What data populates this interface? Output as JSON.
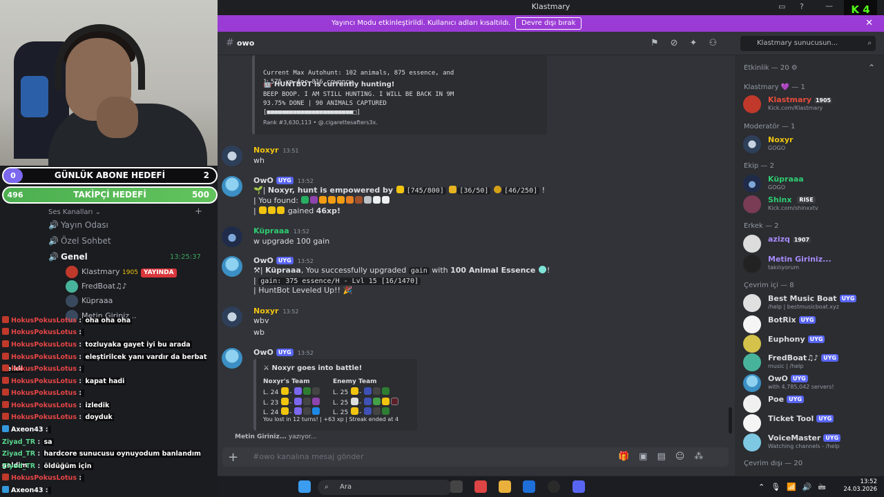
{
  "window": {
    "title": "Klastmary",
    "kick_label": "4"
  },
  "banner": {
    "text": "Yayıncı Modu etkinleştirildi. Kullanıcı adları kısaltıldı.",
    "button": "Devre dışı bırak"
  },
  "channel": {
    "name": "owo",
    "search_placeholder": "Klastmary sunucusun..."
  },
  "goals": [
    {
      "left": "0",
      "title": "GÜNLÜK ABONE HEDEFİ",
      "right": "2"
    },
    {
      "left": "496",
      "title": "TAKİPÇİ HEDEFİ",
      "right": "500"
    }
  ],
  "left": {
    "voice_header": "Ses Kanalları",
    "channels": [
      "Yayın Odası",
      "Özel Sohbet"
    ],
    "genel": {
      "name": "Genel",
      "timer": "13:25:37"
    },
    "voice_users": [
      {
        "name": "Klastmary",
        "tag": "1905",
        "live": "YAYINDA"
      },
      {
        "name": "FredBoat♫♪"
      },
      {
        "name": "Küpraaa"
      },
      {
        "name": "Metin Giriniz..."
      }
    ]
  },
  "overlay_chat": [
    {
      "user": "HokusPokusLotus",
      "msg": "oha oha oha"
    },
    {
      "user": "HokusPokusLotus",
      "msg": ""
    },
    {
      "user": "HokusPokusLotus",
      "msg": "tozluyaka gayet iyi bu arada"
    },
    {
      "user": "HokusPokusLotus",
      "msg": "eleştirilcek yanı vardır da berbat deildi"
    },
    {
      "user": "HokusPokusLotus",
      "msg": ""
    },
    {
      "user": "HokusPokusLotus",
      "msg": "kapat hadi"
    },
    {
      "user": "HokusPokusLotus",
      "msg": ""
    },
    {
      "user": "HokusPokusLotus",
      "msg": "izledik"
    },
    {
      "user": "HokusPokusLotus",
      "msg": "doyduk"
    },
    {
      "user": "Axeon43",
      "msg": ""
    },
    {
      "user": "Ziyad_TR",
      "msg": "sa"
    },
    {
      "user": "Ziyad_TR",
      "msg": "hardcore sunucusu oynuyodum banlandım geldim"
    },
    {
      "user": "Ziyad_TR",
      "msg": "öldüğüm için"
    },
    {
      "user": "HokusPokusLotus",
      "msg": ""
    },
    {
      "user": "Axeon43",
      "msg": ""
    }
  ],
  "messages": {
    "huntbot_embed": {
      "line1": "Current Max Autohunt: 102 animals, 875 essence, and",
      "line2": "1,575 xp for 816 cowoncy",
      "hunting": "HUNTBOT is currently hunting!",
      "beep": "BEEP BOOP. I AM STILL HUNTING. I WILL BE BACK IN 9M",
      "done": "93.75% DONE | 90 ANIMALS CAPTURED",
      "bar": "[■■■■■■■■■■■■■■■■■■■■■■■□]",
      "rank": "Rank #3,630,113 • @.cigarettesafters3x."
    },
    "m1": {
      "user": "Noxyr",
      "time": "13:51",
      "text": "wh"
    },
    "m2": {
      "user": "OwO",
      "badge": "UYG",
      "time": "13:52",
      "l1_user": "Noxyr",
      "l1_rest": ", hunt is empowered by",
      "c1": "[745/800]",
      "c2": "[36/50]",
      "c3": "[46/250]",
      "l1_end": "!",
      "l2": "You found:",
      "l3": "gained",
      "xp": "46xp!"
    },
    "m3": {
      "user": "Küpraaa",
      "time": "13:52",
      "text": "w upgrade 100 gain"
    },
    "m4": {
      "user": "OwO",
      "badge": "UYG",
      "time": "13:52",
      "l1_user": "Küpraaa",
      "l1_rest": ", You successfully upgraded",
      "c1": "gain",
      "with": "with",
      "essence": "100 Animal Essence",
      "l1_end": "!",
      "l2": "gain: 375 essence/H -  Lvl 15 [16/1470]",
      "l3": "HuntBot Leveled Up!!"
    },
    "m5": {
      "user": "Noxyr",
      "time": "13:52",
      "t1": "wbv",
      "t2": "wb"
    },
    "m6": {
      "user": "OwO",
      "badge": "UYG",
      "time": "13:52",
      "title": "Noxyr goes into battle!",
      "team1": "Noxyr's Team",
      "team2": "Enemy Team",
      "t1": [
        "L. 24",
        "L. 23",
        "L. 24"
      ],
      "t2": [
        "L. 25",
        "L. 25",
        "L. 25"
      ],
      "footer": "You lost in 12 turns! | +63 xp | Streak ended at 4"
    }
  },
  "typing": {
    "name": "Metin Giriniz...",
    "suffix": " yazıyor..."
  },
  "composer": {
    "placeholder": "#owo kanalına mesaj gönder"
  },
  "members": {
    "activity": "Etkinlik — 20",
    "groups": [
      {
        "title": "Klastmary 💜 — 1"
      },
      {
        "title": "Moderatör — 1"
      },
      {
        "title": "Ekip — 2"
      },
      {
        "title": "Erkek — 2"
      },
      {
        "title": "Çevrim içi — 8"
      },
      {
        "title": "Çevrim dışı — 20"
      }
    ],
    "list": [
      {
        "name": "Klastmary",
        "tag": "1905",
        "sub": "Kick.com/Klastmary",
        "color": "#e74c3c"
      },
      {
        "name": "Noxyr",
        "sub": "GOGO",
        "color": "#f1c40f"
      },
      {
        "name": "Küpraaa",
        "sub": "GOGO",
        "color": "#2ecc71"
      },
      {
        "name": "Shinx",
        "tag": "RISE",
        "sub": "Kick.com/shinxxtv",
        "color": "#2ecc71"
      },
      {
        "name": "azizq",
        "tag": "1907",
        "sub": "",
        "color": "#a78bfa"
      },
      {
        "name": "Metin Giriniz...",
        "sub": "takılıyorum",
        "color": "#a78bfa"
      },
      {
        "name": "Best Music Boat",
        "tag": "UYG",
        "sub": "/help | bestmusicboat.xyz",
        "color": "#dbdee1"
      },
      {
        "name": "BotRix",
        "tag": "UYG",
        "sub": "",
        "color": "#dbdee1"
      },
      {
        "name": "Euphony",
        "tag": "UYG",
        "sub": "",
        "color": "#dbdee1"
      },
      {
        "name": "FredBoat♫♪",
        "tag": "UYG",
        "sub": "music | /help",
        "color": "#dbdee1"
      },
      {
        "name": "OwO",
        "tag": "UYG",
        "sub": "with 4,785,042 servers!",
        "color": "#dbdee1"
      },
      {
        "name": "Poe",
        "tag": "UYG",
        "sub": "",
        "color": "#dbdee1"
      },
      {
        "name": "Ticket Tool",
        "tag": "UYG",
        "sub": "",
        "color": "#dbdee1"
      },
      {
        "name": "VoiceMaster",
        "tag": "UYG",
        "sub": "Watching channels - /help",
        "color": "#dbdee1"
      }
    ]
  },
  "taskbar": {
    "search": "Ara",
    "time": "13:52",
    "date": "24.03.2026"
  }
}
